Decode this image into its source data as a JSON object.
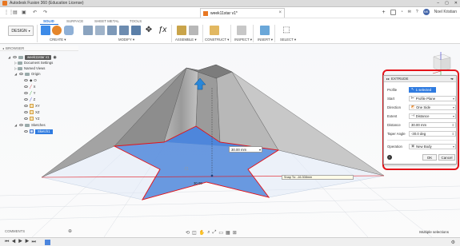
{
  "window": {
    "title": "Autodesk Fusion 360 (Education License)",
    "controls": [
      "–",
      "▢",
      "✕"
    ]
  },
  "doc_tab": {
    "title": "week11star v1*",
    "close": "×"
  },
  "user": {
    "initials": "NK",
    "name": "Noel Kristian",
    "notifications": "1",
    "help": "?"
  },
  "ribbon": {
    "tabs": [
      "SOLID",
      "SURFACE",
      "SHEET METAL",
      "TOOLS"
    ],
    "workspace": "DESIGN",
    "groups": [
      "CREATE ▾",
      "MODIFY ▾",
      "ASSEMBLE ▾",
      "CONSTRUCT ▾",
      "INSPECT ▾",
      "INSERT ▾",
      "SELECT ▾"
    ]
  },
  "browser": {
    "title": "BROWSER",
    "root": "week11star v1",
    "items": [
      "Document Settings",
      "Named Views",
      "Origin",
      "O",
      "X",
      "Y",
      "Z",
      "XY",
      "XZ",
      "YZ",
      "Sketches",
      "Sketch1"
    ]
  },
  "extrude": {
    "title": "EXTRUDE",
    "rows": [
      {
        "label": "Profile",
        "value": "1 selected"
      },
      {
        "label": "Start",
        "value": "Profile Plane"
      },
      {
        "label": "Direction",
        "value": "One Side"
      },
      {
        "label": "Extent",
        "value": "Distance"
      },
      {
        "label": "Distance",
        "value": "30.00 mm"
      },
      {
        "label": "Taper Angle",
        "value": "-30.0 deg"
      },
      {
        "label": "Operation",
        "value": "New Body"
      }
    ],
    "ok": "OK",
    "cancel": "Cancel",
    "info": "i"
  },
  "canvas": {
    "dim_input": "30.00 mm",
    "dim_label": "30.00",
    "snap_tip": "Snap To: -16.308mm"
  },
  "comments": "COMMENTS",
  "status": {
    "selection": "Multiple selections"
  },
  "colors": {
    "accent": "#1f6fd6",
    "highlight": "#e4141a",
    "selection": "#2f7be0"
  }
}
